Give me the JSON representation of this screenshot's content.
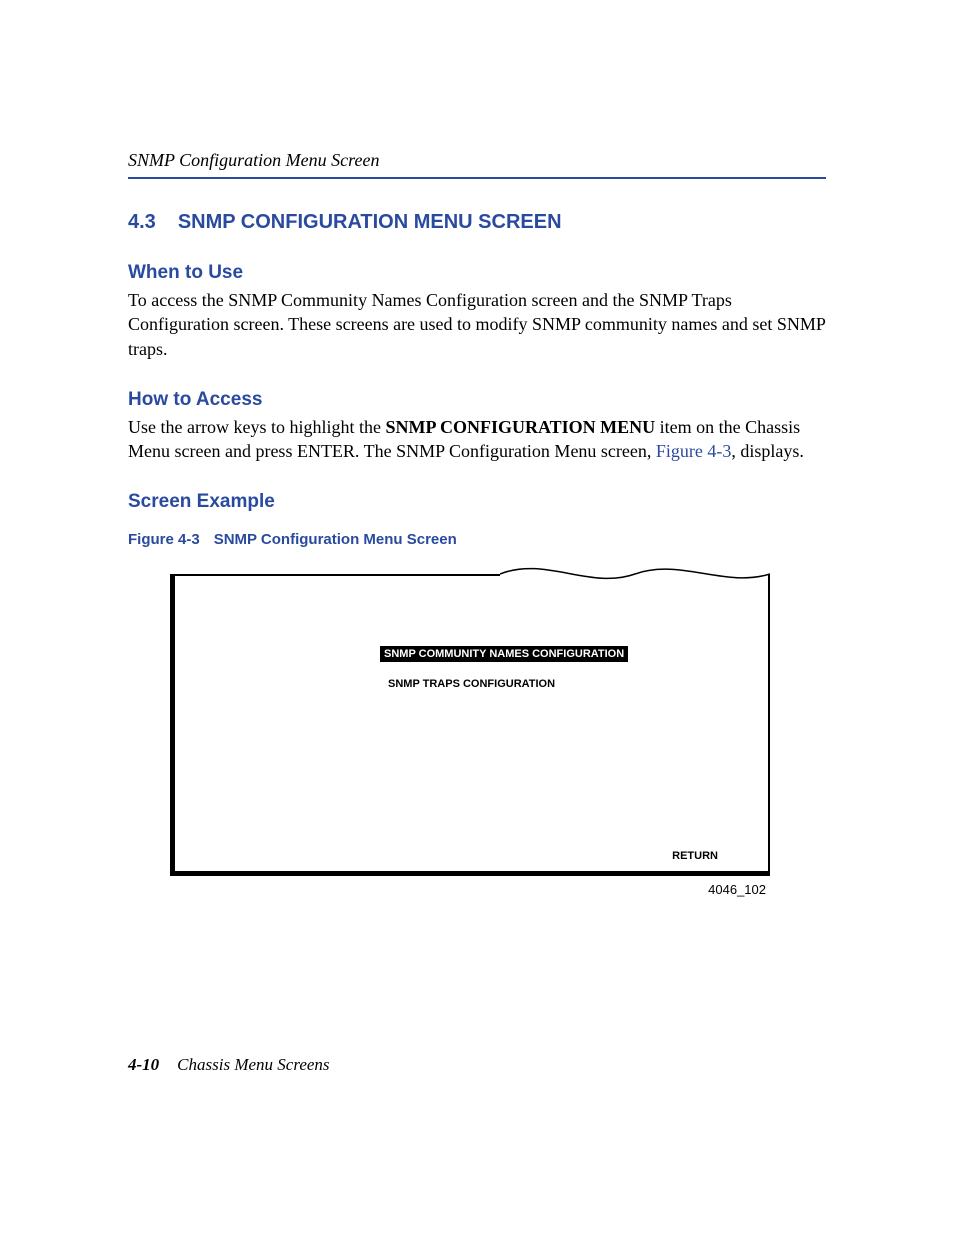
{
  "header": {
    "running": "SNMP Configuration Menu Screen"
  },
  "section": {
    "number": "4.3",
    "title": "SNMP CONFIGURATION MENU SCREEN"
  },
  "when_to_use": {
    "heading": "When to Use",
    "body": "To access the SNMP Community Names Configuration screen and the SNMP Traps Configuration screen. These screens are used to modify SNMP community names and set SNMP traps."
  },
  "how_to_access": {
    "heading": "How to Access",
    "prefix": "Use the arrow keys to highlight the ",
    "bold": "SNMP CONFIGURATION MENU",
    "mid": " item on the Chassis Menu screen and press ENTER. The SNMP Configuration Menu screen, ",
    "link": "Figure 4-3",
    "suffix": ", displays."
  },
  "screen_example": {
    "heading": "Screen Example"
  },
  "figure": {
    "label": "Figure 4-3",
    "title": "SNMP Configuration Menu Screen",
    "menu_items": [
      {
        "text": "SNMP COMMUNITY NAMES CONFIGURATION",
        "selected": true
      },
      {
        "text": "SNMP TRAPS CONFIGURATION",
        "selected": false
      }
    ],
    "return": "RETURN",
    "id": "4046_102"
  },
  "footer": {
    "page": "4-10",
    "title": "Chassis Menu Screens"
  }
}
